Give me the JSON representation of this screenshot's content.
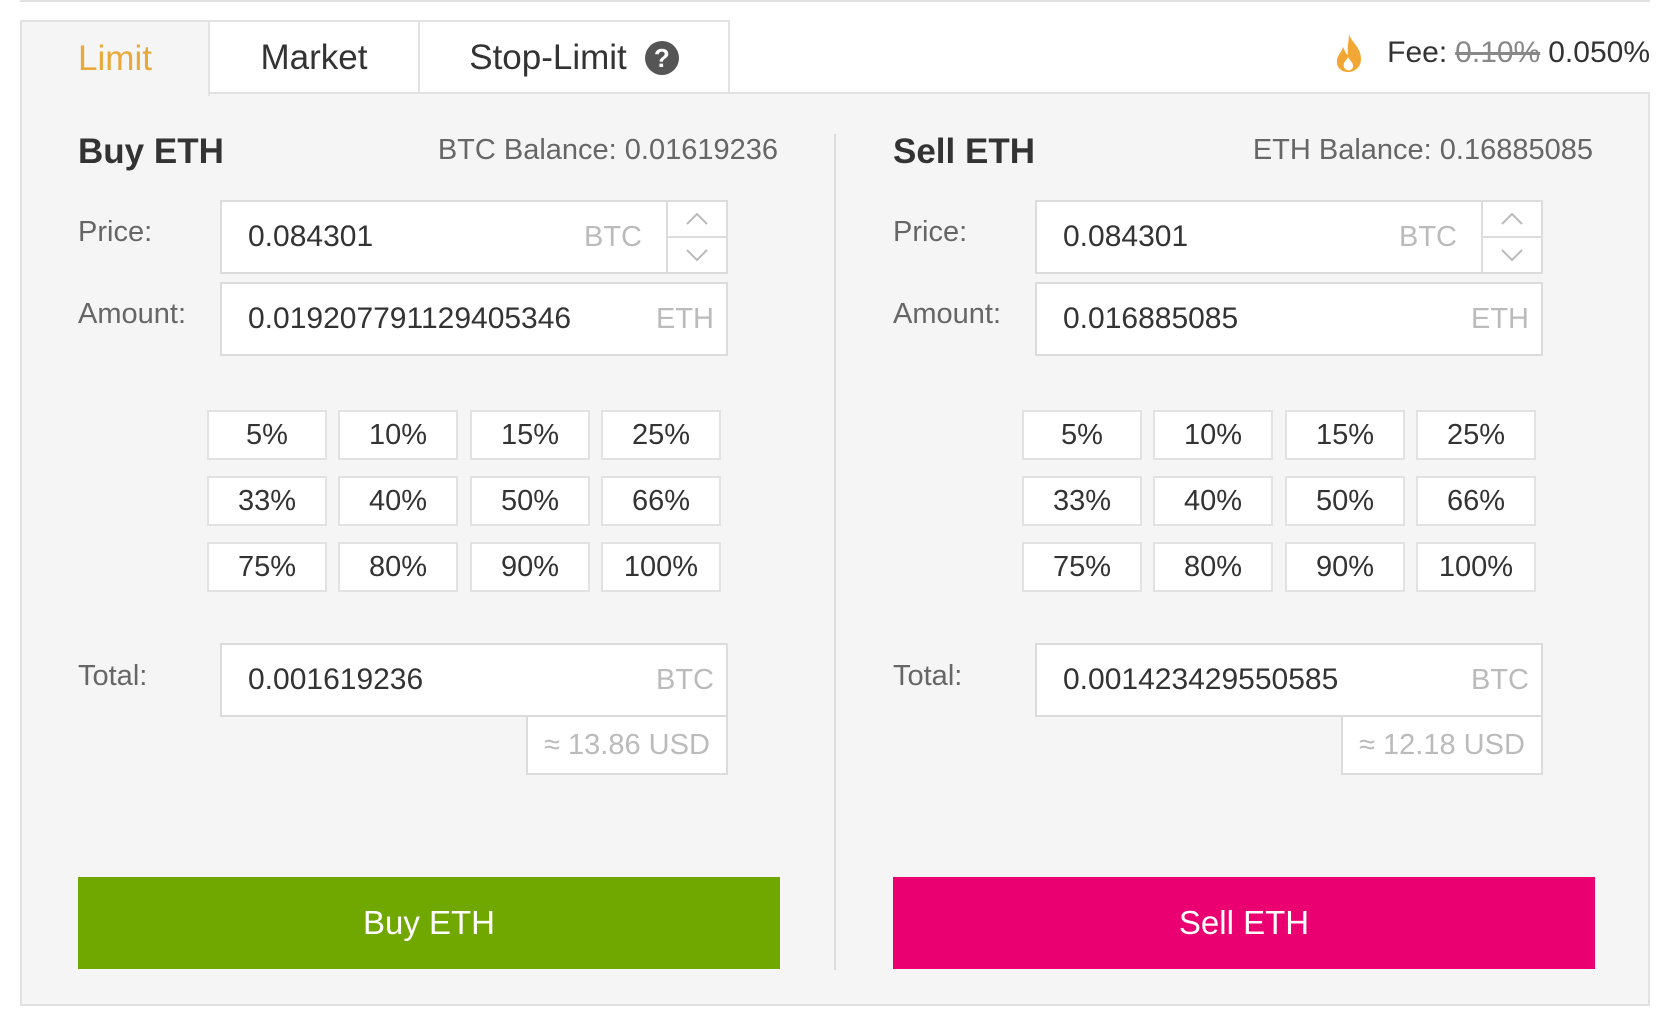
{
  "tabs": [
    {
      "label": "Limit"
    },
    {
      "label": "Market"
    },
    {
      "label": "Stop-Limit"
    }
  ],
  "help_icon": "?",
  "fee": {
    "label": "Fee:",
    "old": "0.10%",
    "current": "0.050%",
    "icon": "flame-icon"
  },
  "colors": {
    "accent": "#e8a93a",
    "buy": "#70a800",
    "sell": "#ea0070"
  },
  "buy": {
    "title": "Buy ETH",
    "balance": "BTC Balance: 0.01619236",
    "price_label": "Price:",
    "price_value": "0.084301",
    "price_unit": "BTC",
    "amount_label": "Amount:",
    "amount_value": "0.019207791129405346",
    "amount_unit": "ETH",
    "percents": [
      "5%",
      "10%",
      "15%",
      "25%",
      "33%",
      "40%",
      "50%",
      "66%",
      "75%",
      "80%",
      "90%",
      "100%"
    ],
    "total_label": "Total:",
    "total_value": "0.001619236",
    "total_unit": "BTC",
    "usd": "≈ 13.86 USD",
    "button": "Buy ETH"
  },
  "sell": {
    "title": "Sell ETH",
    "balance": "ETH Balance: 0.16885085",
    "price_label": "Price:",
    "price_value": "0.084301",
    "price_unit": "BTC",
    "amount_label": "Amount:",
    "amount_value": "0.016885085",
    "amount_unit": "ETH",
    "percents": [
      "5%",
      "10%",
      "15%",
      "25%",
      "33%",
      "40%",
      "50%",
      "66%",
      "75%",
      "80%",
      "90%",
      "100%"
    ],
    "total_label": "Total:",
    "total_value": "0.001423429550585",
    "total_unit": "BTC",
    "usd": "≈ 12.18 USD",
    "button": "Sell ETH"
  }
}
